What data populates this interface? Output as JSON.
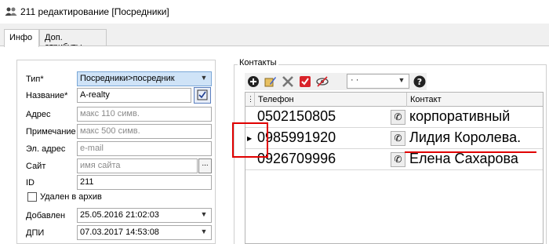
{
  "window": {
    "title": "211 редактирование [Посредники]",
    "icon": "users-icon"
  },
  "tabs": [
    {
      "label": "Инфо"
    },
    {
      "label": "Доп. атрибуты"
    }
  ],
  "form": {
    "type_label": "Тип*",
    "type_value": "Посредники>посредник",
    "name_label": "Название*",
    "name_value": "A-realty",
    "address_label": "Адрес",
    "address_placeholder": "макс 110 симв.",
    "note_label": "Примечание",
    "note_placeholder": "макс 500 симв.",
    "email_label": "Эл. адрес",
    "email_placeholder": "e-mail",
    "site_label": "Сайт",
    "site_placeholder": "имя сайта",
    "site_button": "...",
    "id_label": "ID",
    "id_value": "211",
    "archived_label": "Удален в архив",
    "archived_checked": false,
    "added_label": "Добавлен",
    "added_value": "25.05.2016 21:02:03",
    "dpi_label": "ДПИ",
    "dpi_value": "07.03.2017 14:53:08"
  },
  "contacts": {
    "group_label": "Контакты",
    "filter_value": "· ·",
    "toolbar_icons": [
      "add-icon",
      "edit-icon",
      "delete-icon",
      "check-icon",
      "hide-icon",
      "help-icon"
    ],
    "columns": {
      "phone": "Телефон",
      "contact": "Контакт"
    },
    "rows": [
      {
        "phone": "0502150805",
        "contact": "корпоративный"
      },
      {
        "phone": "0985991920",
        "contact": "Лидия Королева."
      },
      {
        "phone": "0926709996",
        "contact": "Елена Сахарова"
      }
    ],
    "selected_row": 1,
    "annotation_color": "#e00000"
  }
}
